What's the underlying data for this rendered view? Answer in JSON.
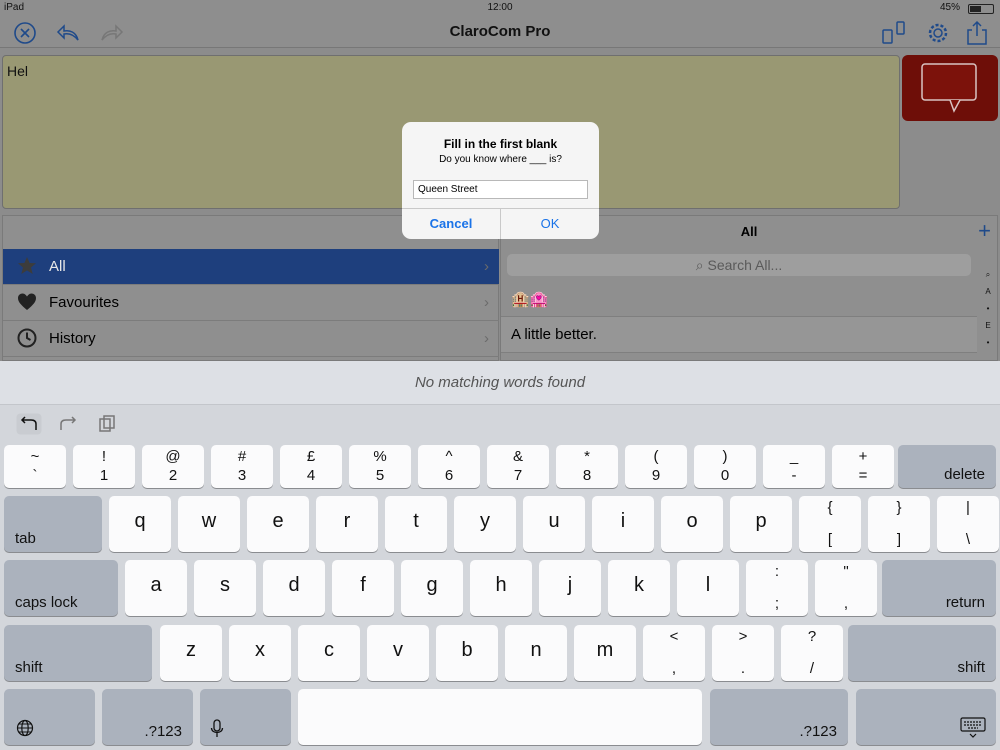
{
  "status": {
    "device": "iPad",
    "time": "12:00",
    "battery": "45%"
  },
  "app": {
    "title": "ClaroCom Pro"
  },
  "editor": {
    "text": "Hel"
  },
  "categories": [
    {
      "label": "All",
      "icon": "star-icon",
      "selected": true
    },
    {
      "label": "Favourites",
      "icon": "heart-icon"
    },
    {
      "label": "History",
      "icon": "clock-icon"
    }
  ],
  "list": {
    "title": "All",
    "search_placeholder": "Search All...",
    "items": [
      "🏨🏩",
      "A little better."
    ],
    "index_letters": [
      "A",
      "•",
      "E",
      "•"
    ]
  },
  "suggestions": {
    "empty_text": "No matching words found"
  },
  "dialog": {
    "title": "Fill in the first blank",
    "message": "Do you know where ___ is?",
    "input_value": "Queen Street",
    "cancel": "Cancel",
    "ok": "OK"
  },
  "keyboard": {
    "row1": [
      [
        "~",
        "`"
      ],
      [
        "!",
        "1"
      ],
      [
        "@",
        "2"
      ],
      [
        "#",
        "3"
      ],
      [
        "£",
        "4"
      ],
      [
        "%",
        "5"
      ],
      [
        "^",
        "6"
      ],
      [
        "&",
        "7"
      ],
      [
        "*",
        "8"
      ],
      [
        "(",
        "9"
      ],
      [
        ")",
        "0"
      ],
      [
        "_",
        "-"
      ],
      [
        "+",
        "="
      ]
    ],
    "delete": "delete",
    "tab": "tab",
    "row2": [
      "q",
      "w",
      "e",
      "r",
      "t",
      "y",
      "u",
      "i",
      "o",
      "p",
      [
        "{",
        "["
      ],
      [
        "}",
        "]"
      ],
      [
        "|",
        "\\"
      ]
    ],
    "caps": "caps lock",
    "row3": [
      "a",
      "s",
      "d",
      "f",
      "g",
      "h",
      "j",
      "k",
      "l",
      [
        ":",
        ";"
      ],
      [
        "\"",
        ","
      ]
    ],
    "return": "return",
    "shift": "shift",
    "row4": [
      "z",
      "x",
      "c",
      "v",
      "b",
      "n",
      "m",
      [
        "<",
        ","
      ],
      [
        ">",
        "."
      ],
      [
        "?",
        "/"
      ]
    ],
    "num": ".?123"
  },
  "colors": {
    "selected_row": "#1e3f7d",
    "accent": "#1a73e8",
    "speak_button": "#6e0e08"
  }
}
